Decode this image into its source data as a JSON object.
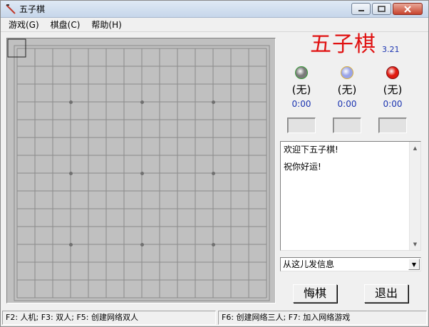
{
  "window": {
    "title": "五子棋",
    "icon": "pen-icon"
  },
  "menu": {
    "items": [
      {
        "label": "游戏(G)"
      },
      {
        "label": "棋盘(C)"
      },
      {
        "label": "帮助(H)"
      }
    ]
  },
  "board": {
    "lines": 15,
    "grid_color": "#8a8a8a",
    "background": "#c0c0c0",
    "star_points": [
      [
        3,
        3
      ],
      [
        3,
        7
      ],
      [
        3,
        11
      ],
      [
        7,
        3
      ],
      [
        7,
        7
      ],
      [
        7,
        11
      ],
      [
        11,
        3
      ],
      [
        11,
        7
      ],
      [
        11,
        11
      ]
    ]
  },
  "panel": {
    "title": "五子棋",
    "version": "3.21",
    "title_color": "#e01010",
    "players": [
      {
        "name": "(无)",
        "time": "0:00",
        "stone_color": "#7a7a7a",
        "ring_color": "#3a9a3a"
      },
      {
        "name": "(无)",
        "time": "0:00",
        "stone_color": "#9aa4e8",
        "ring_color": "#d8b040"
      },
      {
        "name": "(无)",
        "time": "0:00",
        "stone_color": "#e01a10",
        "ring_color": "#801010"
      }
    ]
  },
  "messages": {
    "lines": [
      "欢迎下五子棋!",
      "祝你好运!"
    ]
  },
  "send": {
    "placeholder": "从这儿发信息"
  },
  "buttons": {
    "undo": "悔棋",
    "exit": "退出"
  },
  "status": {
    "left": "F2: 人机; F3: 双人; F5: 创建网络双人",
    "right": "F6: 创建网络三人; F7: 加入网络游戏"
  }
}
